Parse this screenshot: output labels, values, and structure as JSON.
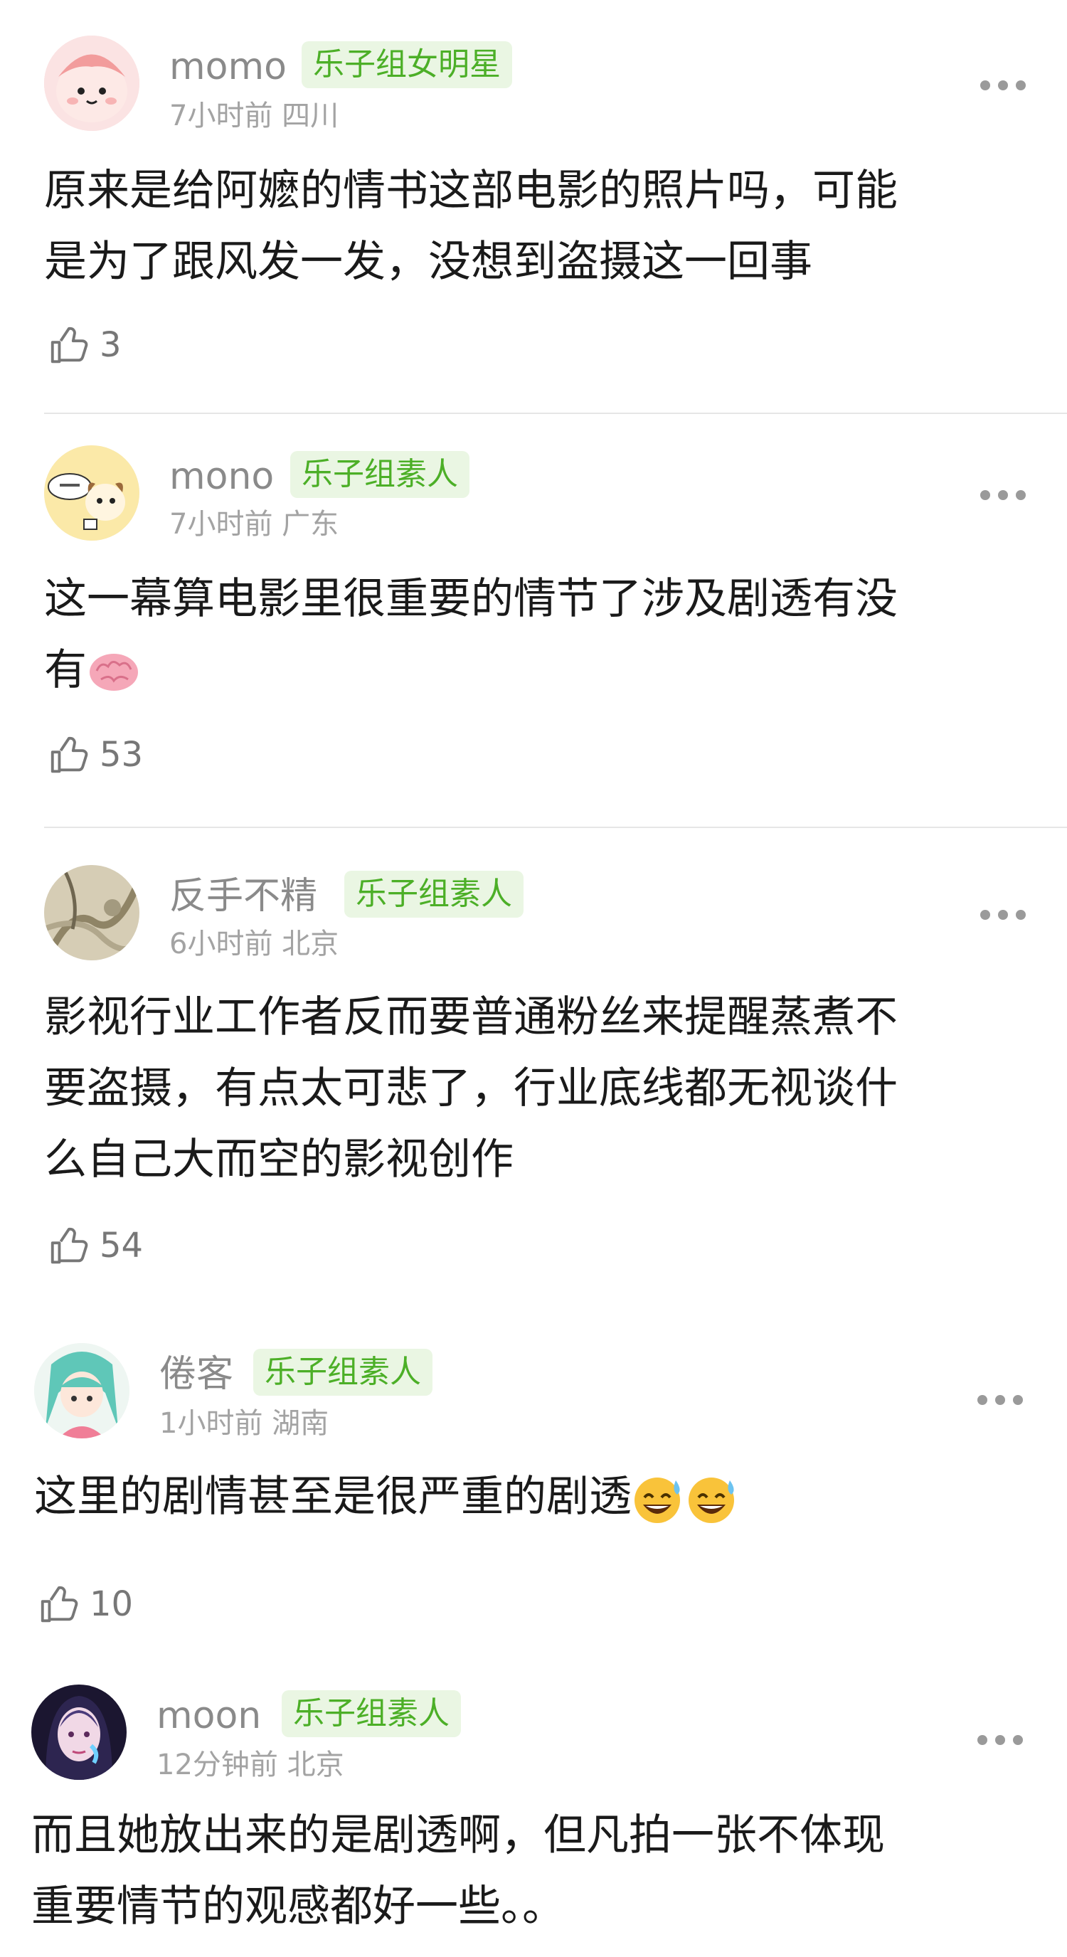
{
  "comments": [
    {
      "name": "momo",
      "badge": "乐子组女明星",
      "time": "7小时前",
      "location": "四川",
      "lines": [
        "原来是给阿嬷的情书这部电影的照片吗，可能",
        "是为了跟风发一发，没想到盗摄这一回事"
      ],
      "likes": "3"
    },
    {
      "name": "mono",
      "badge": "乐子组素人",
      "time": "7小时前",
      "location": "广东",
      "lines": [
        "这一幕算电影里很重要的情节了涉及剧透有没",
        "有"
      ],
      "likes": "53",
      "emoji": "brain"
    },
    {
      "name": "反手不精",
      "badge": "乐子组素人",
      "time": "6小时前",
      "location": "北京",
      "lines": [
        "影视行业工作者反而要普通粉丝来提醒蒸煮不",
        "要盗摄，有点太可悲了，行业底线都无视谈什",
        "么自己大而空的影视创作"
      ],
      "likes": "54"
    },
    {
      "name": "倦客",
      "badge": "乐子组素人",
      "time": "1小时前",
      "location": "湖南",
      "lines": [
        "这里的剧情甚至是很严重的剧透"
      ],
      "likes": "10",
      "emoji": "grinning-sweat"
    },
    {
      "name": "moon",
      "badge": "乐子组素人",
      "time": "12分钟前",
      "location": "北京",
      "lines": [
        "而且她放出来的是剧透啊，但凡拍一张不体现",
        "重要情节的观感都好一些。。"
      ]
    }
  ],
  "icons": {
    "like": "thumbs-up-icon",
    "more": "more-options-icon"
  }
}
